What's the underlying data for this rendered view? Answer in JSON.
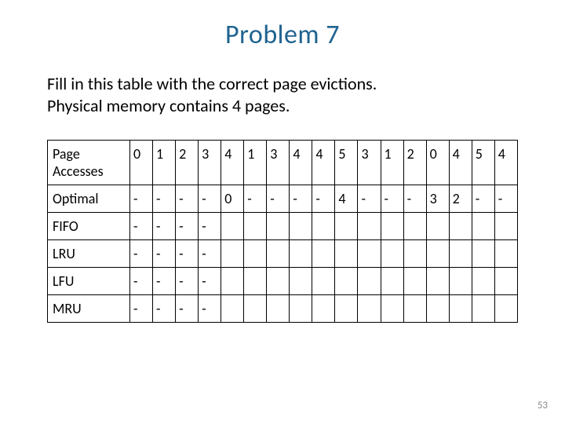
{
  "title": "Problem 7",
  "instructions_line1": "Fill in this table with the correct page evictions.",
  "instructions_line2": "Physical memory contains 4 pages.",
  "page_number": "53",
  "chart_data": {
    "type": "table",
    "row_header_label": "Page Accesses",
    "columns": [
      "0",
      "1",
      "2",
      "3",
      "4",
      "1",
      "3",
      "4",
      "4",
      "5",
      "3",
      "1",
      "2",
      "0",
      "4",
      "5",
      "4"
    ],
    "rows": [
      {
        "label": "Optimal",
        "cells": [
          "-",
          "-",
          "-",
          "-",
          "0",
          "-",
          "-",
          "-",
          "-",
          "4",
          "-",
          "-",
          "-",
          "3",
          "2",
          "-",
          "-"
        ]
      },
      {
        "label": "FIFO",
        "cells": [
          "-",
          "-",
          "-",
          "-",
          "",
          "",
          "",
          "",
          "",
          "",
          "",
          "",
          "",
          "",
          "",
          "",
          ""
        ]
      },
      {
        "label": "LRU",
        "cells": [
          "-",
          "-",
          "-",
          "-",
          "",
          "",
          "",
          "",
          "",
          "",
          "",
          "",
          "",
          "",
          "",
          "",
          ""
        ]
      },
      {
        "label": "LFU",
        "cells": [
          "-",
          "-",
          "-",
          "-",
          "",
          "",
          "",
          "",
          "",
          "",
          "",
          "",
          "",
          "",
          "",
          "",
          ""
        ]
      },
      {
        "label": "MRU",
        "cells": [
          "-",
          "-",
          "-",
          "-",
          "",
          "",
          "",
          "",
          "",
          "",
          "",
          "",
          "",
          "",
          "",
          "",
          ""
        ]
      }
    ]
  }
}
